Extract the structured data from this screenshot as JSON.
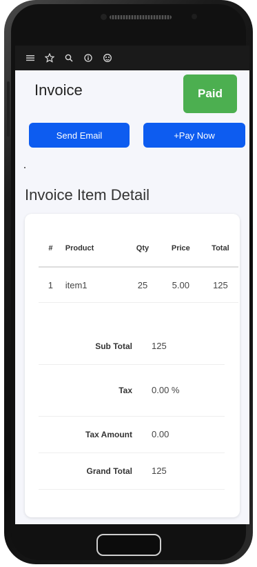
{
  "invoice": {
    "title": "Invoice",
    "status_badge": "Paid",
    "send_email_label": "Send Email",
    "pay_now_label": "+Pay Now"
  },
  "section_title": "Invoice Item Detail",
  "items_table": {
    "headers": [
      "#",
      "Product",
      "Qty",
      "Price",
      "Total"
    ],
    "rows": [
      [
        "1",
        "item1",
        "25",
        "5.00",
        "125"
      ]
    ]
  },
  "totals": {
    "sub_total_label": "Sub Total",
    "sub_total_value": "125",
    "tax_label": "Tax",
    "tax_value": "0.00 %",
    "tax_amount_label": "Tax Amount",
    "tax_amount_value": "0.00",
    "grand_total_label": "Grand Total",
    "grand_total_value": "125"
  },
  "status_bar_icons": [
    "menu-icon",
    "star-icon",
    "search-icon",
    "info-icon",
    "settings-icon"
  ],
  "colors": {
    "primary_button": "#0d5cf0",
    "paid_badge": "#4caf50",
    "background": "#f5f6fb"
  }
}
